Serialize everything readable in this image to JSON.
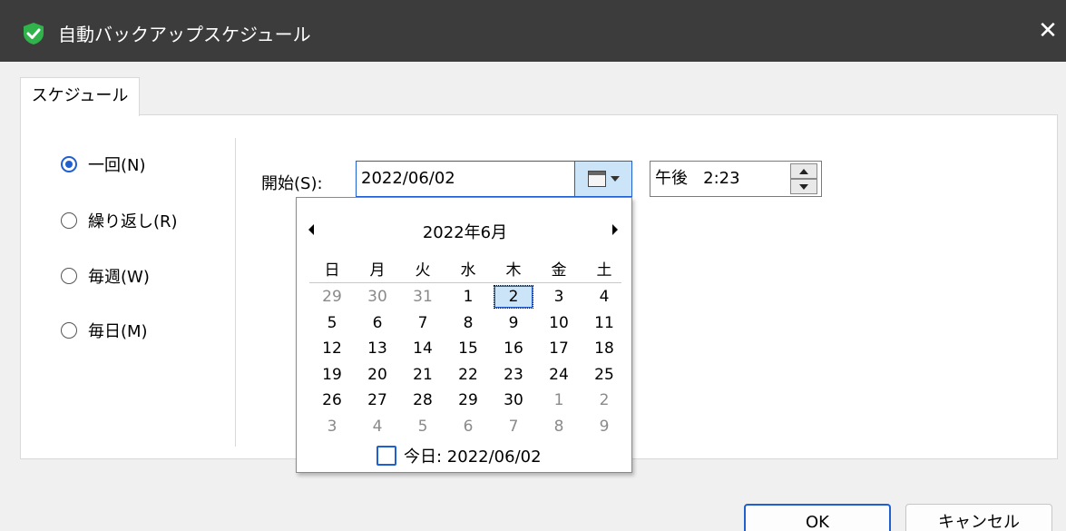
{
  "window": {
    "title": "自動バックアップスケジュール",
    "close_glyph": "✕",
    "accent_color": "#1f5fd1",
    "titlebar_color": "#3c3c3c"
  },
  "tabs": [
    {
      "label": "スケジュール",
      "selected": true
    }
  ],
  "schedule_type": {
    "options": [
      {
        "label": "一回(N)",
        "checked": true
      },
      {
        "label": "繰り返し(R)",
        "checked": false
      },
      {
        "label": "毎週(W)",
        "checked": false
      },
      {
        "label": "毎日(M)",
        "checked": false
      }
    ]
  },
  "start": {
    "label": "開始(S):",
    "date_value": "2022/06/02",
    "time_value": "午後   2:23"
  },
  "calendar": {
    "title": "2022年6月",
    "weekdays": [
      "日",
      "月",
      "火",
      "水",
      "木",
      "金",
      "土"
    ],
    "weeks": [
      [
        "29",
        "30",
        "31",
        "1",
        "2",
        "3",
        "4"
      ],
      [
        "5",
        "6",
        "7",
        "8",
        "9",
        "10",
        "11"
      ],
      [
        "12",
        "13",
        "14",
        "15",
        "16",
        "17",
        "18"
      ],
      [
        "19",
        "20",
        "21",
        "22",
        "23",
        "24",
        "25"
      ],
      [
        "26",
        "27",
        "28",
        "29",
        "30",
        "1",
        "2"
      ],
      [
        "3",
        "4",
        "5",
        "6",
        "7",
        "8",
        "9"
      ]
    ],
    "gray_days": [
      [
        0,
        0
      ],
      [
        0,
        1
      ],
      [
        0,
        2
      ],
      [
        4,
        5
      ],
      [
        4,
        6
      ],
      [
        5,
        0
      ],
      [
        5,
        1
      ],
      [
        5,
        2
      ],
      [
        5,
        3
      ],
      [
        5,
        4
      ],
      [
        5,
        5
      ],
      [
        5,
        6
      ]
    ],
    "selected_day": [
      0,
      4
    ],
    "today_label": "今日: 2022/06/02"
  },
  "footer": {
    "ok_label": "OK",
    "cancel_label": "キャンセル"
  }
}
